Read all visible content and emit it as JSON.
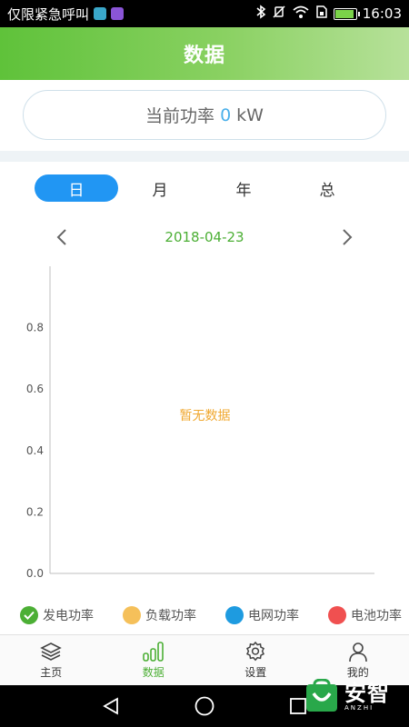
{
  "status_bar": {
    "carrier_text": "仅限紧急呼叫",
    "time": "16:03",
    "notification_colors": [
      "#3aa7c9",
      "#8a55d6"
    ],
    "battery_level": 0.9
  },
  "header": {
    "title": "数据"
  },
  "current_power": {
    "label": "当前功率",
    "value": "0",
    "unit": "kW"
  },
  "tabs": [
    {
      "label": "日",
      "active": true
    },
    {
      "label": "月",
      "active": false
    },
    {
      "label": "年",
      "active": false
    },
    {
      "label": "总",
      "active": false
    }
  ],
  "date_nav": {
    "date": "2018-04-23",
    "prev_icon": "chevron-left-icon",
    "next_icon": "chevron-right-icon"
  },
  "chart_data": {
    "type": "line",
    "title": "",
    "xlabel": "",
    "ylabel": "",
    "ylim": [
      0,
      1
    ],
    "yticks": [
      "0.0",
      "0.2",
      "0.4",
      "0.6",
      "0.8"
    ],
    "series": [],
    "empty_message": "暂无数据",
    "grid": false
  },
  "legend": [
    {
      "label": "发电功率",
      "color": "#4caf35",
      "icon": "check-icon"
    },
    {
      "label": "负载功率",
      "color": "#f5c05a",
      "icon": "dot-icon"
    },
    {
      "label": "电网功率",
      "color": "#1e9be0",
      "icon": "dot-icon"
    },
    {
      "label": "电池功率",
      "color": "#f05050",
      "icon": "dot-icon"
    }
  ],
  "bottom_nav": [
    {
      "label": "主页",
      "icon": "layers-icon",
      "active": false
    },
    {
      "label": "数据",
      "icon": "bar-chart-icon",
      "active": true
    },
    {
      "label": "设置",
      "icon": "gear-icon",
      "active": false
    },
    {
      "label": "我的",
      "icon": "person-icon",
      "active": false
    }
  ],
  "watermark": {
    "text": "安智",
    "sub": "ANZHI"
  }
}
